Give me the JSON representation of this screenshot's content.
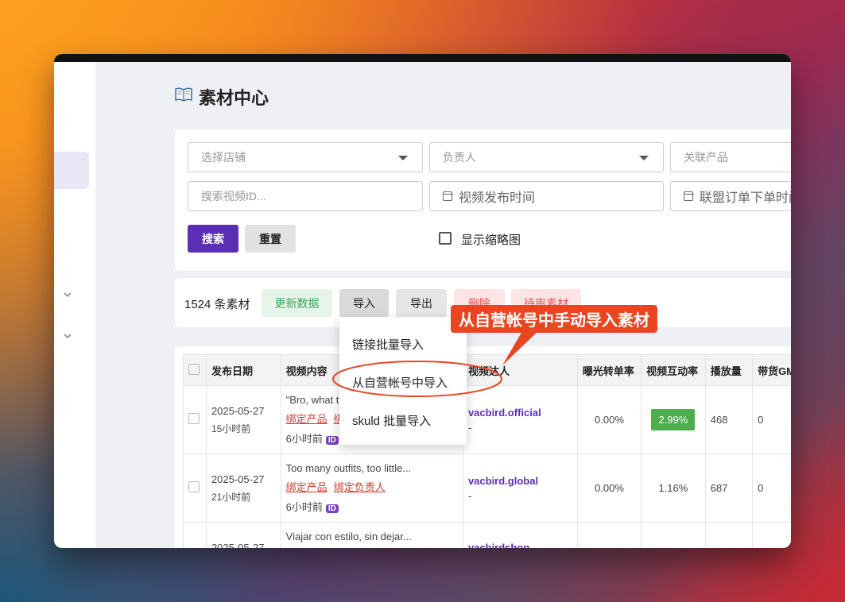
{
  "page": {
    "title": "素材中心",
    "title_icon": "book-icon"
  },
  "filters": {
    "store_placeholder": "选择店铺",
    "owner_placeholder": "负责人",
    "product_placeholder": "关联产品",
    "video_id_placeholder": "搜索视频ID...",
    "publish_time_placeholder": "视频发布时间",
    "affiliate_time_placeholder": "联盟订单下单时间",
    "search_label": "搜索",
    "reset_label": "重置",
    "thumbnail_label": "显示缩略图"
  },
  "toolbar": {
    "count": "1524 条素材",
    "update_label": "更新数据",
    "import_label": "导入",
    "export_label": "导出",
    "delete_label": "删除",
    "review_label": "待审素材"
  },
  "dropdown": {
    "items": [
      "链接批量导入",
      "从自营帐号中导入",
      "skuld 批量导入"
    ]
  },
  "callout": {
    "text": "从自营帐号中手动导入素材"
  },
  "table": {
    "columns": [
      "发布日期",
      "视频内容",
      "视频达人",
      "曝光转单率",
      "视频互动率",
      "播放量",
      "带货GMV"
    ],
    "link_product": "绑定产品",
    "link_owner": "绑定负责人",
    "rows": [
      {
        "date": "2025-05-27",
        "ago": "15小时前",
        "content": "\"Bro, what t",
        "posted": "6小时前",
        "creator": "vacbird.official",
        "creator_sub": "-",
        "ctr": "0.00%",
        "engagement": "2.99%",
        "views": "468",
        "gmv": "0"
      },
      {
        "date": "2025-05-27",
        "ago": "21小时前",
        "content": "Too many outfits, too little...",
        "posted": "6小时前",
        "creator": "vacbird.global",
        "creator_sub": "-",
        "ctr": "0.00%",
        "engagement": "1.16%",
        "views": "687",
        "gmv": "0"
      },
      {
        "date": "2025-05-27",
        "ago": "",
        "content": "Viajar con estilo, sin dejar...",
        "posted": "",
        "creator": "vacbirdshop",
        "creator_sub": "",
        "ctr": "",
        "engagement": "",
        "views": "",
        "gmv": ""
      }
    ]
  },
  "colors": {
    "primary": "#5b2fb5",
    "accent_red": "#e94521",
    "success": "#4cae4c"
  }
}
